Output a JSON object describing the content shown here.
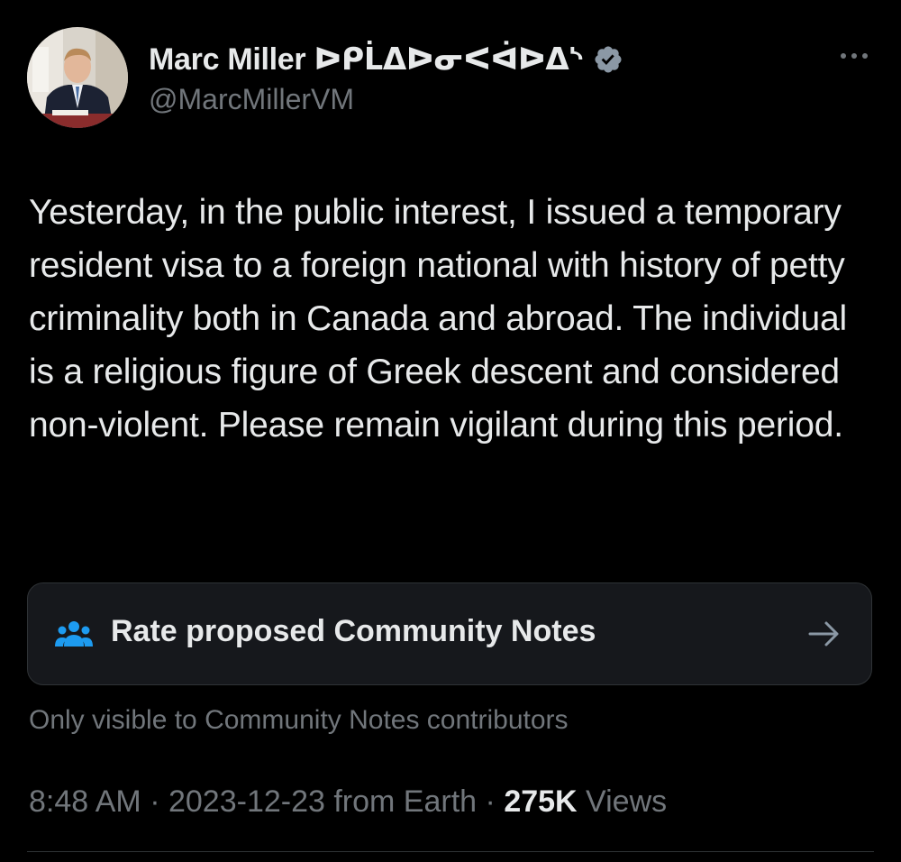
{
  "author": {
    "display_name": "Marc Miller ᐅᑭᒫᐃᐅᓂᐸᐋᐅᐃᔅ",
    "handle": "@MarcMillerVM",
    "verified": true
  },
  "tweet": {
    "text": "Yesterday, in the public interest, I issued a temporary resident visa to a foreign national with history of petty criminality both in Canada and abroad.   The individual is a religious figure of Greek descent and considered non-violent. Please remain vigilant during this period."
  },
  "community_notes": {
    "label": "Rate proposed Community Notes",
    "visibility_note": "Only visible to Community Notes contributors"
  },
  "meta": {
    "time": "8:48 AM",
    "separator": "·",
    "date": "2023-12-23",
    "source": "from Earth",
    "views_count": "275K",
    "views_label": "Views"
  },
  "icons": {
    "verified": "verified-badge-icon",
    "more": "more-horizontal-icon",
    "community_notes": "people-icon",
    "arrow": "arrow-right-icon"
  },
  "colors": {
    "background": "#000000",
    "primary_text": "#e7e9ea",
    "secondary_text": "#71767b",
    "accent": "#1d9bf0",
    "card_border": "#2f3336"
  }
}
